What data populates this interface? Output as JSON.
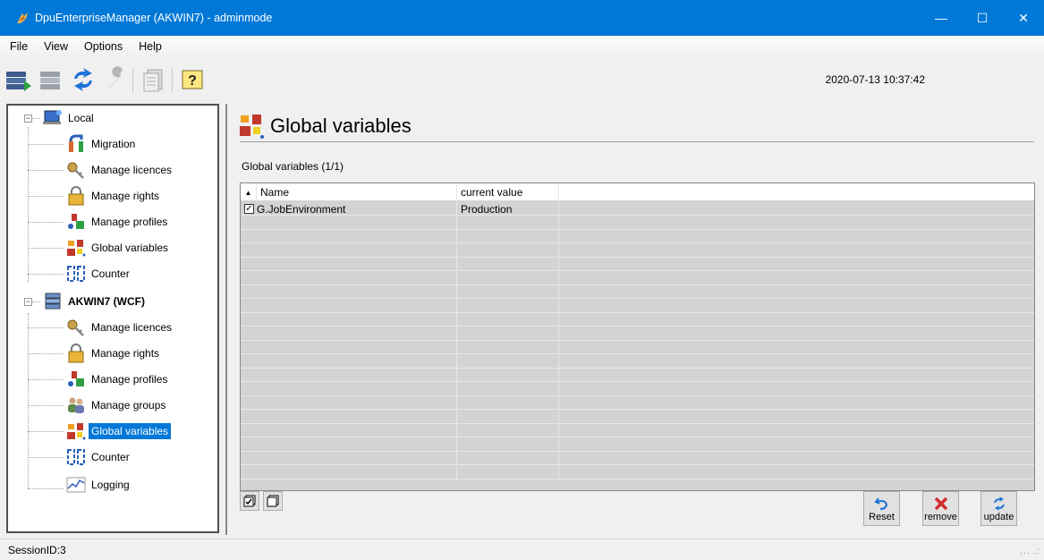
{
  "window": {
    "title": "DpuEnterpriseManager (AKWIN7) - adminmode",
    "minimize": "—",
    "maximize": "☐",
    "close": "✕"
  },
  "menu": [
    "File",
    "View",
    "Options",
    "Help"
  ],
  "toolbar": {
    "timestamp": "2020-07-13 10:37:42"
  },
  "tree": {
    "local": {
      "label": "Local",
      "items": [
        "Migration",
        "Manage licences",
        "Manage rights",
        "Manage profiles",
        "Global variables",
        "Counter"
      ]
    },
    "server": {
      "label": "AKWIN7 (WCF)",
      "items": [
        "Manage licences",
        "Manage rights",
        "Manage profiles",
        "Manage groups",
        "Global variables",
        "Counter",
        "Logging"
      ]
    }
  },
  "main": {
    "title": "Global variables",
    "grid_label": "Global variables (1/1)",
    "columns": [
      "Name",
      "current value"
    ],
    "sort_indicator": "▲",
    "rows": [
      {
        "checked": true,
        "name": "G.JobEnvironment",
        "value": "Production"
      }
    ],
    "buttons": {
      "reset": "Reset",
      "remove": "remove",
      "update": "update"
    }
  },
  "status": {
    "session": "SessionID:3",
    "grip": "... .:"
  },
  "colors": {
    "accent": "#0078d7",
    "selection": "#0078d7",
    "grid_bg": "#d3d3d3"
  }
}
